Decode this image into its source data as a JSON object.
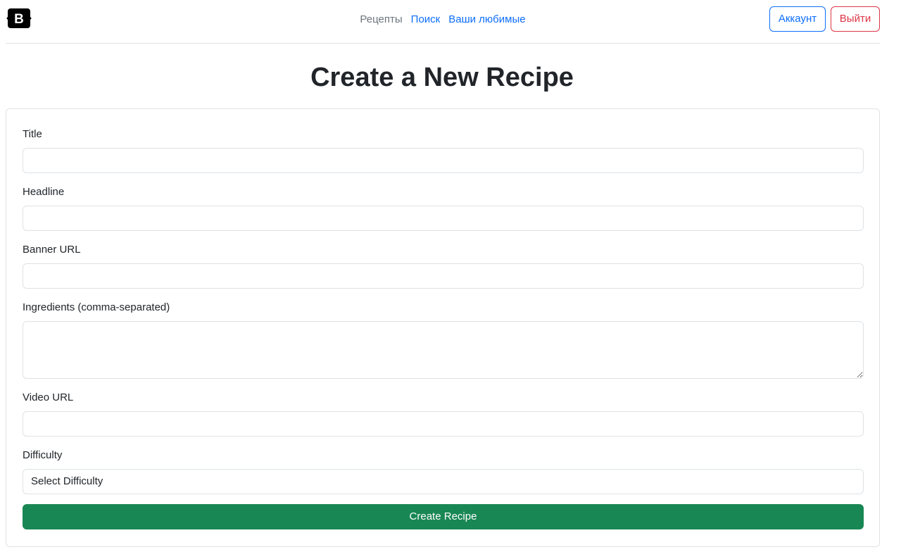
{
  "brand": {
    "logo_letter": "B",
    "logo_color": "#000000"
  },
  "nav": {
    "links": [
      {
        "label": "Рецепты",
        "active": true
      },
      {
        "label": "Поиск",
        "active": false
      },
      {
        "label": "Ваши любимые",
        "active": false
      }
    ],
    "account_label": "Аккаунт",
    "logout_label": "Выйти"
  },
  "page": {
    "title": "Create a New Recipe"
  },
  "form": {
    "title_label": "Title",
    "title_value": "",
    "headline_label": "Headline",
    "headline_value": "",
    "banner_label": "Banner URL",
    "banner_value": "",
    "ingredients_label": "Ingredients (comma-separated)",
    "ingredients_value": "",
    "video_label": "Video URL",
    "video_value": "",
    "difficulty_label": "Difficulty",
    "difficulty_selected": "Select Difficulty",
    "submit_label": "Create Recipe"
  },
  "colors": {
    "primary": "#0d6efd",
    "danger": "#dc3545",
    "success": "#198754",
    "muted": "#6c757d"
  }
}
